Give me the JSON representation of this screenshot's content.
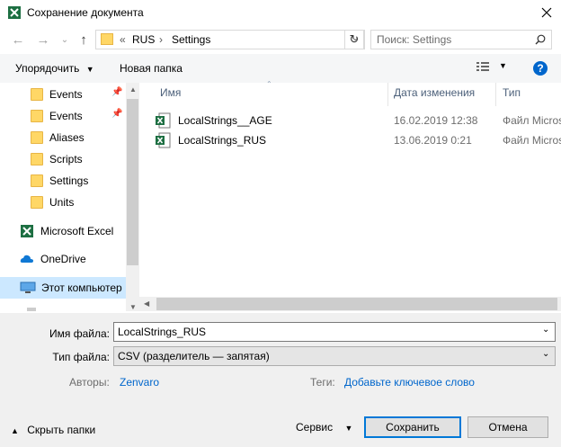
{
  "window": {
    "title": "Сохранение документа"
  },
  "address": {
    "prefix": "«",
    "path": [
      "RUS",
      "Settings"
    ]
  },
  "search": {
    "placeholder": "Поиск: Settings"
  },
  "toolbar": {
    "organize": "Упорядочить",
    "new_folder": "Новая папка",
    "help": "?"
  },
  "sidebar": {
    "items": [
      {
        "label": "Events",
        "type": "folder",
        "pinned": true
      },
      {
        "label": "Events",
        "type": "folder",
        "pinned": true
      },
      {
        "label": "Aliases",
        "type": "folder"
      },
      {
        "label": "Scripts",
        "type": "folder"
      },
      {
        "label": "Settings",
        "type": "folder"
      },
      {
        "label": "Units",
        "type": "folder"
      },
      {
        "label": "Microsoft Excel",
        "type": "excel"
      },
      {
        "label": "OneDrive",
        "type": "onedrive"
      },
      {
        "label": "Этот компьютер",
        "type": "computer",
        "selected": true
      }
    ]
  },
  "columns": {
    "name": "Имя",
    "date": "Дата изменения",
    "type": "Тип"
  },
  "files": [
    {
      "name": "LocalStrings__AGE",
      "date": "16.02.2019 12:38",
      "type": "Файл Micros"
    },
    {
      "name": "LocalStrings_RUS",
      "date": "13.06.2019 0:21",
      "type": "Файл Micros"
    }
  ],
  "form": {
    "filename_label": "Имя файла:",
    "filename_value": "LocalStrings_RUS",
    "filetype_label": "Тип файла:",
    "filetype_value": "CSV (разделитель — запятая)",
    "authors_label": "Авторы:",
    "authors_value": "Zenvaro",
    "tags_label": "Теги:",
    "tags_value": "Добавьте ключевое слово"
  },
  "footer": {
    "hide_folders": "Скрыть папки",
    "service": "Сервис",
    "save": "Сохранить",
    "cancel": "Отмена"
  },
  "colors": {
    "accent": "#0078d7",
    "excel": "#1d6f42",
    "link": "#0066cc",
    "selected": "#cce8ff"
  }
}
